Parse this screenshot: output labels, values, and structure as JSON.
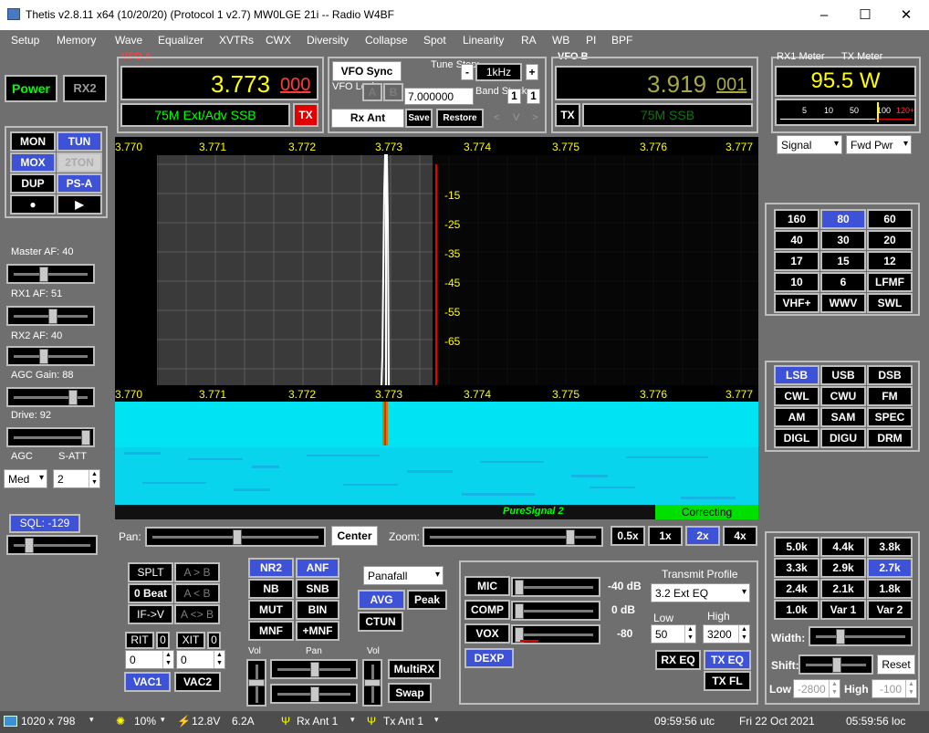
{
  "window": {
    "title": "Thetis v2.8.11 x64 (10/20/20) (Protocol 1 v2.7) MW0LGE 21i  --  Radio W4BF",
    "minimize": "–",
    "maximize": "☐",
    "close": "✕"
  },
  "menu": [
    "Setup",
    "Memory",
    "Wave",
    "Equalizer",
    "XVTRs",
    "CWX",
    "Diversity",
    "Collapse",
    "Spot",
    "Linearity",
    "RA",
    "WB",
    "PI",
    "BPF"
  ],
  "power": {
    "power": "Power",
    "rx2": "RX2"
  },
  "mon_grid": [
    "MON",
    "TUN",
    "MOX",
    "2TON",
    "DUP",
    "PS-A",
    "●",
    "▶"
  ],
  "vfoa": {
    "label": "VFO A",
    "freq_main": "3.773",
    "freq_sub": "000",
    "mode_label": "75M Ext/Adv SSB",
    "tx": "TX"
  },
  "vfosync": {
    "sync": "VFO Sync",
    "lock": "VFO Lock:",
    "a": "A",
    "b": "B",
    "value": "7.000000",
    "rx_ant": "Rx Ant",
    "save": "Save",
    "restore": "Restore",
    "tune_step": "Tune Step:",
    "step_value": "1kHz",
    "minus": "-",
    "plus": "+",
    "band_stack": "Band Stack",
    "bs1": "1",
    "bs2": "1",
    "lt": "<",
    "v": "V",
    "gt": ">"
  },
  "vfob": {
    "label": "VFO B",
    "freq_main": "3.919",
    "freq_sub": "001",
    "tx": "TX",
    "mode_label": "75M SSB"
  },
  "meter": {
    "rx1": "RX1 Meter",
    "tx": "TX Meter",
    "value": "95.5 W",
    "scale": [
      "5",
      "10",
      "50",
      "100",
      "120+"
    ],
    "sel1": "Signal",
    "sel2": "Fwd Pwr"
  },
  "panadapter": {
    "freqs": [
      "3.770",
      "3.771",
      "3.772",
      "3.773",
      "3.774",
      "3.775",
      "3.776",
      "3.777"
    ],
    "db": [
      "-15",
      "-25",
      "-35",
      "-45",
      "-55",
      "-65"
    ],
    "puresignal": "PureSignal 2",
    "correcting": "Correcting"
  },
  "left": {
    "master_af": "Master AF:  40",
    "rx1_af": "RX1 AF:  51",
    "rx2_af": "RX2 AF:  40",
    "agc_gain": "AGC Gain:  88",
    "drive": "Drive:  92",
    "agc": "AGC",
    "satt": "S-ATT",
    "agc_mode": "Med",
    "satt_val": "2",
    "sql": "SQL: -129"
  },
  "bands": [
    "160",
    "80",
    "60",
    "40",
    "30",
    "20",
    "17",
    "15",
    "12",
    "10",
    "6",
    "LFMF",
    "VHF+",
    "WWV",
    "SWL"
  ],
  "modes": [
    "LSB",
    "USB",
    "DSB",
    "CWL",
    "CWU",
    "FM",
    "AM",
    "SAM",
    "SPEC",
    "DIGL",
    "DIGU",
    "DRM"
  ],
  "pan_zoom": {
    "pan": "Pan:",
    "center": "Center",
    "zoom": "Zoom:",
    "z1": "0.5x",
    "z2": "1x",
    "z3": "2x",
    "z4": "4x"
  },
  "split": {
    "splt": "SPLT",
    "atob": "A > B",
    "zerobeat": "0 Beat",
    "btoa": "A < B",
    "ifv": "IF->V",
    "swap": "A <> B",
    "rit": "RIT",
    "rit_val": "0",
    "xit": "XIT",
    "xit_val": "0",
    "rit_spin": "0",
    "xit_spin": "0",
    "vac1": "VAC1",
    "vac2": "VAC2"
  },
  "dsp": {
    "nr2": "NR2",
    "anf": "ANF",
    "nb": "NB",
    "snb": "SNB",
    "mut": "MUT",
    "bin": "BIN",
    "mnf": "MNF",
    "pmnf": "+MNF",
    "vol": "Vol",
    "pan": "Pan",
    "vol2": "Vol",
    "multirx": "MultiRX",
    "swapbtn": "Swap"
  },
  "display": {
    "mode": "Panafall",
    "avg": "AVG",
    "peak": "Peak",
    "ctun": "CTUN"
  },
  "tx": {
    "mic": "MIC",
    "mic_val": "-40 dB",
    "comp": "COMP",
    "comp_val": "0 dB",
    "vox": "VOX",
    "vox_val": "-80",
    "dexp": "DEXP",
    "profile_label": "Transmit Profile",
    "profile": "3.2 Ext EQ",
    "low": "Low",
    "low_val": "50",
    "high": "High",
    "high_val": "3200",
    "rxeq": "RX EQ",
    "txeq": "TX EQ",
    "txfl": "TX FL"
  },
  "filters": {
    "items": [
      "5.0k",
      "4.4k",
      "3.8k",
      "3.3k",
      "2.9k",
      "2.7k",
      "2.4k",
      "2.1k",
      "1.8k",
      "1.0k",
      "Var 1",
      "Var 2"
    ],
    "width": "Width:",
    "shift": "Shift:",
    "reset": "Reset",
    "low": "Low",
    "low_val": "-2800",
    "high": "High",
    "high_val": "-100"
  },
  "statusbar": {
    "res": "1020 x 798",
    "cpu": "10%",
    "volt": "12.8V",
    "amp": "6.2A",
    "rxant": "Rx Ant  1",
    "txant": "Tx Ant  1",
    "utc": "09:59:56 utc",
    "date": "Fri 22 Oct 2021",
    "loc": "05:59:56 loc"
  },
  "colors": {
    "accent": "#3d52d6",
    "yellow": "#ffff00",
    "green": "#00ff00",
    "waterfall": "#00e3f2",
    "red": "#e80000"
  }
}
